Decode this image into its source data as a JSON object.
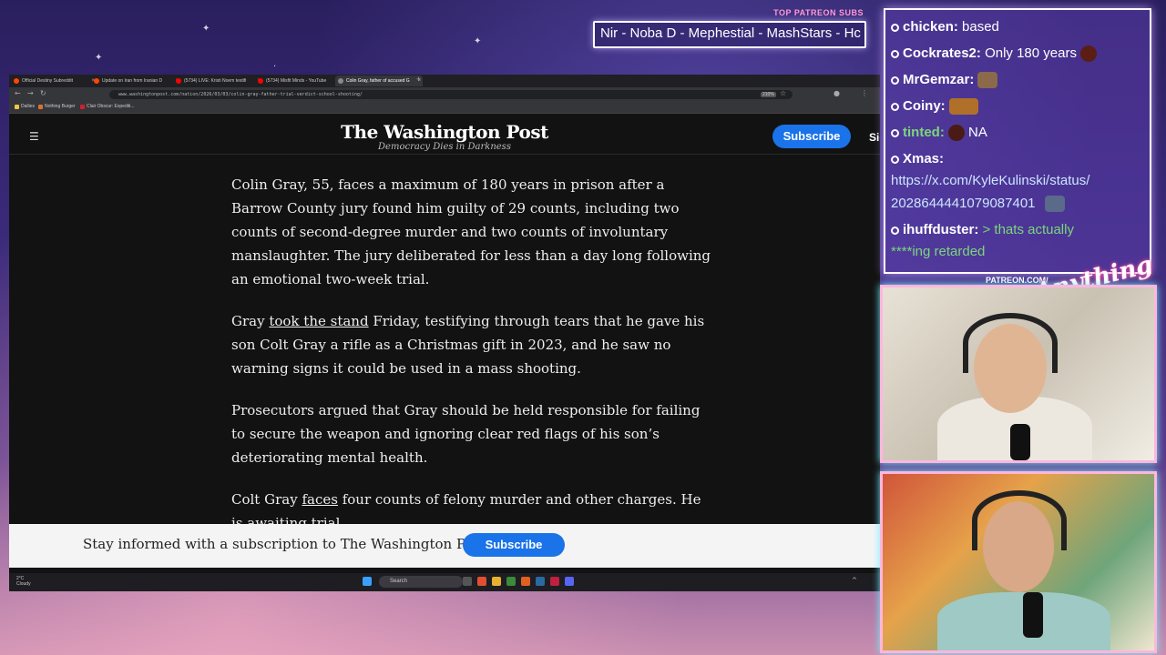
{
  "stream": {
    "patreon_label": "TOP PATREON SUBS",
    "patreon_ticker": "Nir - Noba D - Mephestial - MashStars - Hc",
    "patreon_url": "PATREON.COM/",
    "brand": "Anything Else"
  },
  "browser": {
    "tabs": [
      {
        "label": "Official Destiny Subreddit",
        "color": "#ff4500"
      },
      {
        "label": "Update on Iran from Iranian D",
        "color": "#ff4500"
      },
      {
        "label": "(5734) LIVE: Kristi Noem testifi",
        "color": "#ff0000"
      },
      {
        "label": "(5734) Misfit Minds - YouTube",
        "color": "#ff0000"
      },
      {
        "label": "Colin Gray, father of accused G",
        "color": "#888888"
      }
    ],
    "url": "www.washingtonpost.com/nation/2026/03/03/colin-gray-father-trial-verdict-school-shooting/",
    "zoom": "210%",
    "bookmarks": [
      "Dailies",
      "Nothing Burger",
      "Clair Obscur: Expediti..."
    ]
  },
  "site": {
    "logo": "The Washington Post",
    "tagline": "Democracy Dies in Darkness",
    "subscribe": "Subscribe",
    "signin": "Sign in"
  },
  "article": {
    "p1": "Colin Gray, 55, faces a maximum of 180 years in prison after a Barrow County jury found him guilty of 29 counts, including two counts of second-degree murder and two counts of involuntary manslaughter. The jury deliberated for less than a day long following an emotional two-week trial.",
    "p2_pre": "Gray ",
    "p2_link": "took the stand",
    "p2_post": " Friday, testifying through tears that he gave his son Colt Gray a rifle as a Christmas gift in 2023, and he saw no warning signs it could be used in a mass shooting.",
    "p3": "Prosecutors argued that Gray should be held responsible for failing to secure the weapon and ignoring clear red flags of his son’s deteriorating mental health.",
    "p4_pre": "Colt Gray ",
    "p4_link": "faces",
    "p4_post": " four counts of felony murder and other charges. He is awaiting trial."
  },
  "banner": {
    "text": "Stay informed with a subscription to The Washington Post.",
    "button": "Subscribe"
  },
  "taskbar": {
    "temp": "2°C",
    "weather": "Cloudy",
    "search": "Search"
  },
  "chat": [
    {
      "user": "chicken:",
      "msg": "based",
      "dot": "#ffffff",
      "style": "plain"
    },
    {
      "user": "Cockrates2:",
      "msg": "Only 180 years",
      "dot": "#ffffff",
      "style": "plain",
      "emote": "#5a1e14"
    },
    {
      "user": "MrGemzar:",
      "msg": "",
      "dot": "#ffffff",
      "style": "plain",
      "emote": "#8a6a4a"
    },
    {
      "user": "Coiny:",
      "msg": "",
      "dot": "#ffffff",
      "style": "plain",
      "emote": "#b0702a"
    },
    {
      "user": "tinted:",
      "msg": "NA",
      "dot": "#ffffff",
      "style": "green_user",
      "emote": "#4a1a14"
    },
    {
      "user": "Xmas:",
      "msg": "",
      "dot": "#ffffff",
      "style": "plain"
    },
    {
      "user": "",
      "msg": "https://x.com/KyleKulinski/status/",
      "dot": "",
      "style": "link"
    },
    {
      "user": "",
      "msg": "2028644441079087401",
      "dot": "",
      "style": "link",
      "emote": "#5a6a8a"
    },
    {
      "user": "ihuffduster:",
      "msg": "> thats actually",
      "dot": "#ffffff",
      "style": "green"
    },
    {
      "user": "",
      "msg": "****ing retarded",
      "dot": "",
      "style": "green"
    }
  ]
}
